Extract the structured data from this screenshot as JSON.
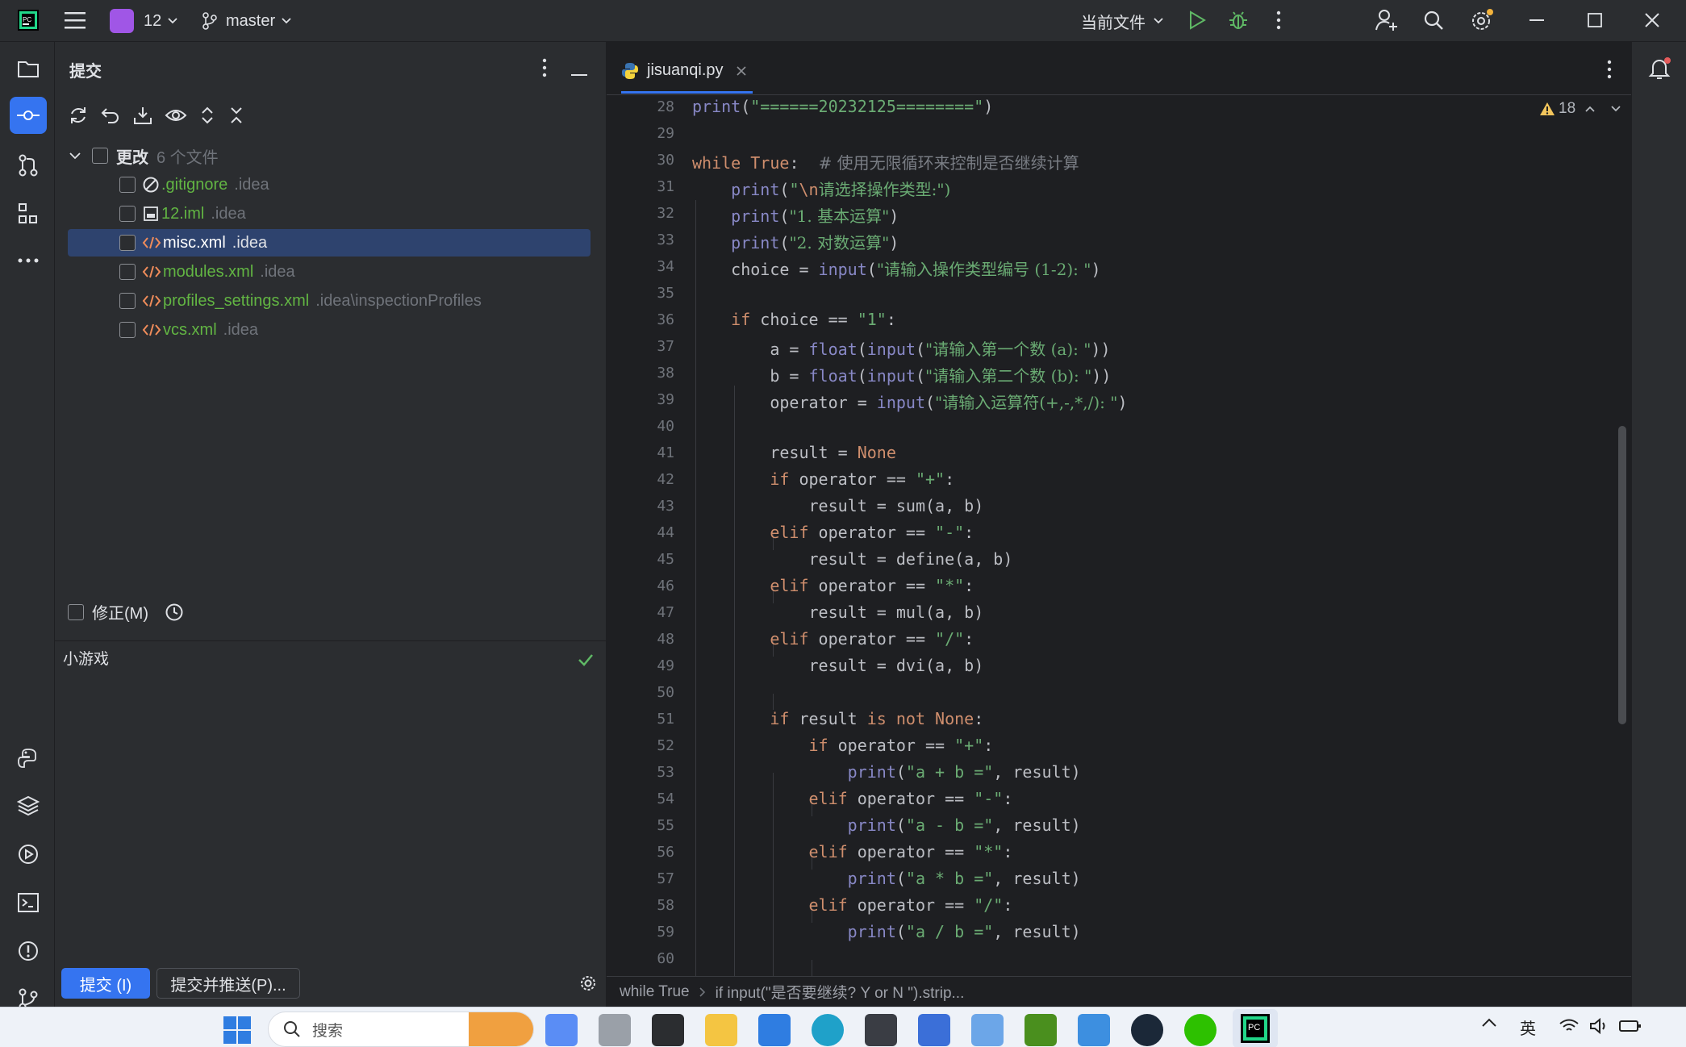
{
  "titlebar": {
    "project_badge": "12",
    "branch": "master",
    "run_config": "当前文件"
  },
  "commit_panel": {
    "title": "提交",
    "changes_label": "更改",
    "changes_count": "6 个文件",
    "files": [
      {
        "name": ".gitignore",
        "dir": ".idea"
      },
      {
        "name": "12.iml",
        "dir": ".idea"
      },
      {
        "name": "misc.xml",
        "dir": ".idea"
      },
      {
        "name": "modules.xml",
        "dir": ".idea"
      },
      {
        "name": "profiles_settings.xml",
        "dir": ".idea\\inspectionProfiles"
      },
      {
        "name": "vcs.xml",
        "dir": ".idea"
      }
    ],
    "amend_label": "修正(M)",
    "commit_message": "小游戏",
    "commit_button": "提交 (I)",
    "commit_push_button": "提交并推送(P)..."
  },
  "editor": {
    "tab_name": "jisuanqi.py",
    "warning_count": "18",
    "line_numbers": [
      "28",
      "29",
      "30",
      "31",
      "32",
      "33",
      "34",
      "35",
      "36",
      "37",
      "38",
      "39",
      "40",
      "41",
      "42",
      "43",
      "44",
      "45",
      "46",
      "47",
      "48",
      "49",
      "50",
      "51",
      "52",
      "53",
      "54",
      "55",
      "56",
      "57",
      "58",
      "59",
      "60"
    ],
    "breadcrumb": [
      "while True",
      "if input(\"是否要继续? Y or N \").strip..."
    ],
    "code": {
      "l28": "\"======20232125========\"",
      "l30_comment": "# 使用无限循环来控制是否继续计算",
      "l31_str": "请选择操作类型:\")",
      "l32_str": "\"1. 基本运算\"",
      "l33_str": "\"2. 对数运算\"",
      "l34_str": "\"请输入操作类型编号 (1-2): \"",
      "l37_str": "\"请输入第一个数 (a): \"",
      "l38_str": "\"请输入第二个数 (b): \"",
      "l39_str": "\"请输入运算符(+,-,*,/): \""
    }
  },
  "taskbar": {
    "search_placeholder": "搜索",
    "ime": "英"
  }
}
